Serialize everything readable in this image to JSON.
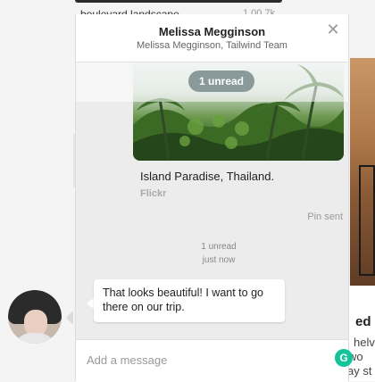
{
  "background": {
    "top_text": "boulevard landscape",
    "top_right_text": "1.00 7k",
    "right_title": "ed",
    "right_line1": "helv",
    "right_line2": "wo",
    "right_line3": "everyday st"
  },
  "chat": {
    "name": "Melissa Megginson",
    "subtitle": "Melissa Megginson, Tailwind Team",
    "unread_pill": "1 unread",
    "pin": {
      "title": "Island Paradise, Thailand.",
      "source": "Flickr",
      "status": "Pin sent"
    },
    "meta": {
      "unread": "1 unread",
      "time": "just now"
    },
    "message": "That looks beautiful! I want to go there on our trip.",
    "composer": {
      "placeholder": "Add a message",
      "value": ""
    }
  },
  "icons": {
    "close": "close-icon",
    "grammarly": "grammarly-icon",
    "avatar": "avatar"
  },
  "colors": {
    "unread_pill": "#8a9a9b",
    "grammarly": "#15c39a"
  }
}
